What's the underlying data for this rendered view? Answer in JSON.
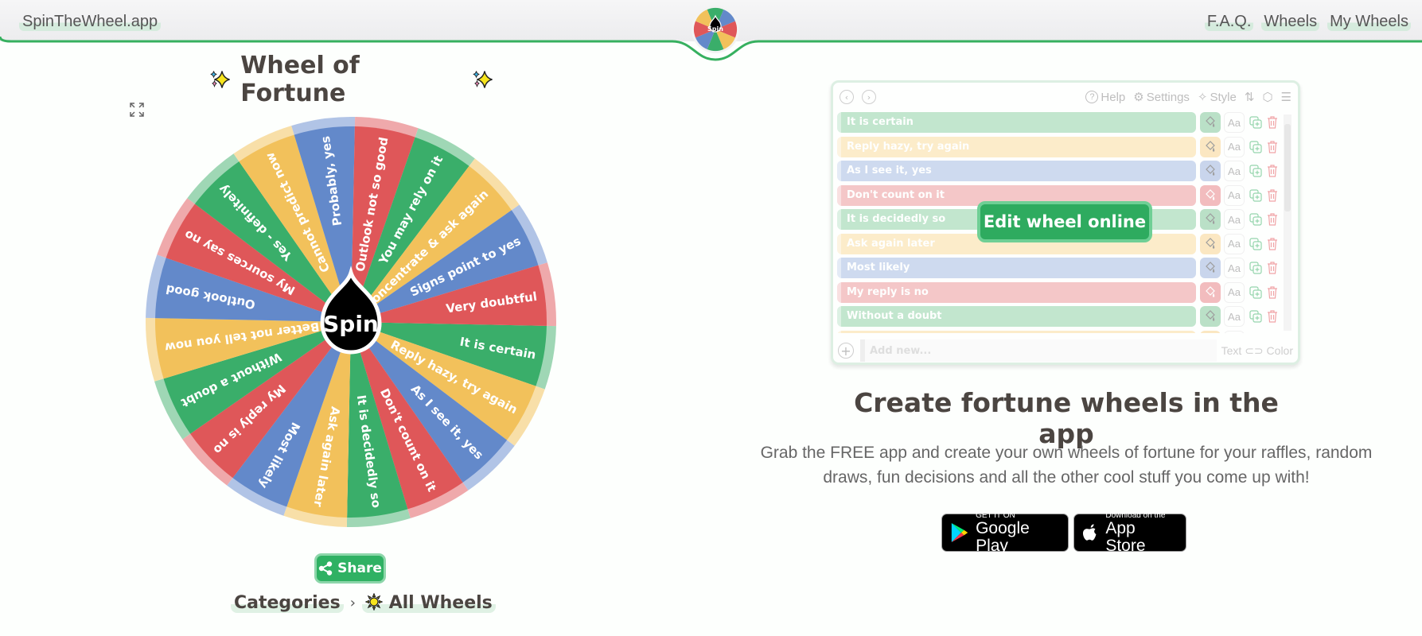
{
  "header": {
    "brand": "SpinTheWheel.app",
    "logo_label": "Spin",
    "nav": [
      {
        "label": "F.A.Q."
      },
      {
        "label": "Wheels"
      },
      {
        "label": "My Wheels"
      }
    ],
    "accent": "#36b05f"
  },
  "wheel": {
    "title": "Wheel of Fortune",
    "spin_label": "Spin",
    "colors": {
      "green": "#3aae6a",
      "yellow": "#f2c15b",
      "blue": "#6389ca",
      "red": "#df5759"
    },
    "segments": [
      {
        "label": "It is certain",
        "color": "green"
      },
      {
        "label": "Reply hazy, try again",
        "color": "yellow"
      },
      {
        "label": "As I see it, yes",
        "color": "blue"
      },
      {
        "label": "Don't count on it",
        "color": "red"
      },
      {
        "label": "It is decidedly so",
        "color": "green"
      },
      {
        "label": "Ask again later",
        "color": "yellow"
      },
      {
        "label": "Most likely",
        "color": "blue"
      },
      {
        "label": "My reply is no",
        "color": "red"
      },
      {
        "label": "Without a doubt",
        "color": "green"
      },
      {
        "label": "Better not tell you now",
        "color": "yellow"
      },
      {
        "label": "Outlook good",
        "color": "blue"
      },
      {
        "label": "My sources say no",
        "color": "red"
      },
      {
        "label": "Yes - definitely",
        "color": "green"
      },
      {
        "label": "Cannot predict now",
        "color": "yellow"
      },
      {
        "label": "Probably, yes",
        "color": "blue"
      },
      {
        "label": "Outlook not so good",
        "color": "red"
      },
      {
        "label": "You may rely on it",
        "color": "green"
      },
      {
        "label": "Concentrate & ask again",
        "color": "yellow"
      },
      {
        "label": "Signs point to yes",
        "color": "blue"
      },
      {
        "label": "Very doubtful",
        "color": "red"
      }
    ],
    "share_label": "Share",
    "breadcrumbs": [
      "Categories",
      "All Wheels"
    ],
    "breadcrumb_separator": "›"
  },
  "editor": {
    "toolbar": {
      "help": "Help",
      "settings": "Settings",
      "style": "Style"
    },
    "rows": [
      {
        "label": "It is certain",
        "color": "green"
      },
      {
        "label": "Reply hazy, try again",
        "color": "yellow"
      },
      {
        "label": "As I see it, yes",
        "color": "blue"
      },
      {
        "label": "Don't count on it",
        "color": "red"
      },
      {
        "label": "It is decidedly so",
        "color": "green"
      },
      {
        "label": "Ask again later",
        "color": "yellow"
      },
      {
        "label": "Most likely",
        "color": "blue"
      },
      {
        "label": "My reply is no",
        "color": "red"
      },
      {
        "label": "Without a doubt",
        "color": "green"
      },
      {
        "label": "",
        "color": "yellow"
      }
    ],
    "row_colors": {
      "green": "#bfe5cc",
      "yellow": "#fcebc8",
      "blue": "#ccd9ef",
      "red": "#f4c5c6"
    },
    "bucket_colors": {
      "green": "#b7dfc5",
      "yellow": "#fbe6bf",
      "blue": "#c7d3ec",
      "red": "#f2b9bb"
    },
    "font_button": "Aa",
    "add_placeholder": "Add new...",
    "text_color_toggle": "Text ⊂⊃ Color",
    "edit_online": "Edit wheel online"
  },
  "promo": {
    "heading": "Create fortune wheels in the app",
    "description": "Grab the FREE app and create your own wheels of fortune for your raffles, random draws, fun decisions and all the other cool stuff you come up with!",
    "google_play": {
      "small": "GET IT ON",
      "big": "Google Play"
    },
    "app_store": {
      "small": "Download on the",
      "big": "App Store"
    }
  }
}
